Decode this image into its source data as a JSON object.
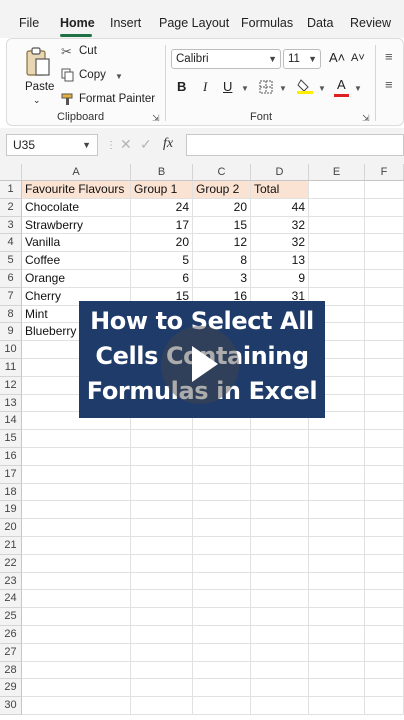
{
  "menu": {
    "tabs": [
      "File",
      "Home",
      "Insert",
      "Page Layout",
      "Formulas",
      "Data",
      "Review"
    ],
    "active": "Home"
  },
  "ribbon": {
    "clipboard": {
      "paste": "Paste",
      "cut": "Cut",
      "copy": "Copy",
      "format_painter": "Format Painter",
      "label": "Clipboard"
    },
    "font": {
      "name": "Calibri",
      "size": "11",
      "bold": "B",
      "italic": "I",
      "underline": "U",
      "grow": "A˄",
      "shrink": "A˅",
      "label": "Font",
      "highlight_color": "#ffee00",
      "font_color": "#e02020"
    }
  },
  "formula_bar": {
    "name_box": "U35",
    "fx": "fx",
    "value": ""
  },
  "sheet": {
    "columns": [
      "A",
      "B",
      "C",
      "D",
      "E",
      "F"
    ],
    "rows": [
      "1",
      "2",
      "3",
      "4",
      "5",
      "6",
      "7",
      "8",
      "9",
      "10",
      "11",
      "12",
      "13",
      "14",
      "15",
      "16",
      "17",
      "18",
      "19",
      "20",
      "21",
      "22",
      "23",
      "24",
      "25",
      "26",
      "27",
      "28",
      "29",
      "30"
    ],
    "header_row": [
      "Favourite Flavours",
      "Group 1",
      "Group 2",
      "Total"
    ],
    "data": [
      [
        "Chocolate",
        "24",
        "20",
        "44"
      ],
      [
        "Strawberry",
        "17",
        "15",
        "32"
      ],
      [
        "Vanilla",
        "20",
        "12",
        "32"
      ],
      [
        "Coffee",
        "5",
        "8",
        "13"
      ],
      [
        "Orange",
        "6",
        "3",
        "9"
      ],
      [
        "Cherry",
        "15",
        "16",
        "31"
      ],
      [
        "Mint",
        "",
        "",
        ""
      ],
      [
        "Blueberry",
        "",
        "",
        ""
      ]
    ]
  },
  "overlay": {
    "lines": [
      "How to Select All",
      "Cells Containing",
      "Formulas in Excel"
    ],
    "background": "#1f3b6a"
  }
}
